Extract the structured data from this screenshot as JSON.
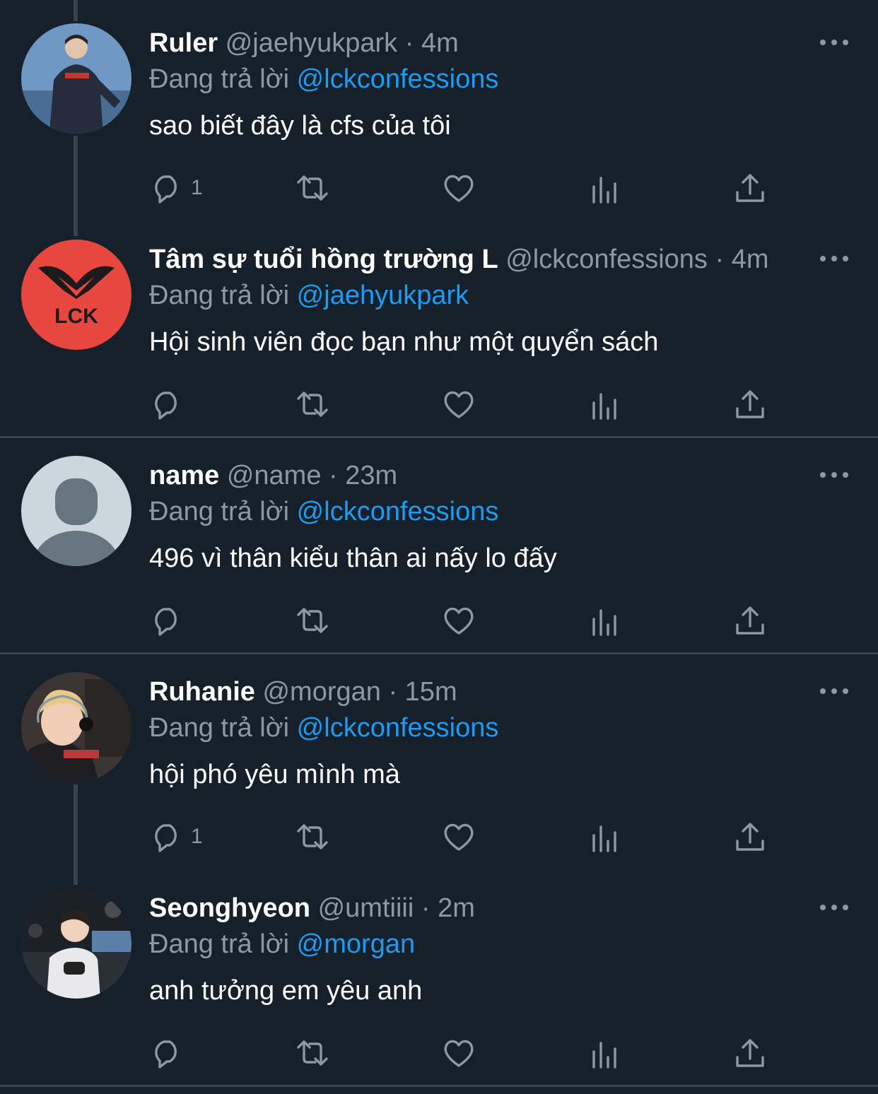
{
  "tweets": [
    {
      "display_name": "Ruler",
      "handle": "@jaehyukpark",
      "separator": "·",
      "time": "4m",
      "reply_prefix": "Đang trả lời",
      "reply_to": "@lckconfessions",
      "text": "sao biết đây là cfs của tôi",
      "reply_count": "1",
      "avatar": "photo-player-jacket"
    },
    {
      "display_name": "Tâm sự tuổi hồng trường L",
      "handle": "@lckconfessions",
      "separator": "·",
      "time": "4m",
      "reply_prefix": "Đang trả lời",
      "reply_to": "@jaehyukpark",
      "text": "Hội sinh viên đọc bạn như một quyển sách",
      "reply_count": "",
      "avatar": "lck-logo",
      "avatar_logo_text": "LCK"
    },
    {
      "display_name": "name",
      "handle": "@name",
      "separator": "·",
      "time": "23m",
      "reply_prefix": "Đang trả lời",
      "reply_to": "@lckconfessions",
      "text": "496 vì thân kiểu thân ai nấy lo đấy",
      "reply_count": "",
      "avatar": "default-profile"
    },
    {
      "display_name": "Ruhanie",
      "handle": "@morgan",
      "separator": "·",
      "time": "15m",
      "reply_prefix": "Đang trả lời",
      "reply_to": "@lckconfessions",
      "text": "hội phó yêu mình mà",
      "reply_count": "1",
      "avatar": "photo-player-headset"
    },
    {
      "display_name": "Seonghyeon",
      "handle": "@umtiiii",
      "separator": "·",
      "time": "2m",
      "reply_prefix": "Đang trả lời",
      "reply_to": "@morgan",
      "text": "anh tưởng em yêu anh",
      "reply_count": "",
      "avatar": "photo-player-stage"
    }
  ],
  "colors": {
    "background": "#15202b",
    "text": "#ffffff",
    "muted": "#8b98a5",
    "accent": "#1d9bf0",
    "divider": "#38444d",
    "lck_red": "#e8473f"
  },
  "icons": [
    "reply-icon",
    "retweet-icon",
    "like-icon",
    "analytics-icon",
    "share-icon",
    "more-icon"
  ]
}
